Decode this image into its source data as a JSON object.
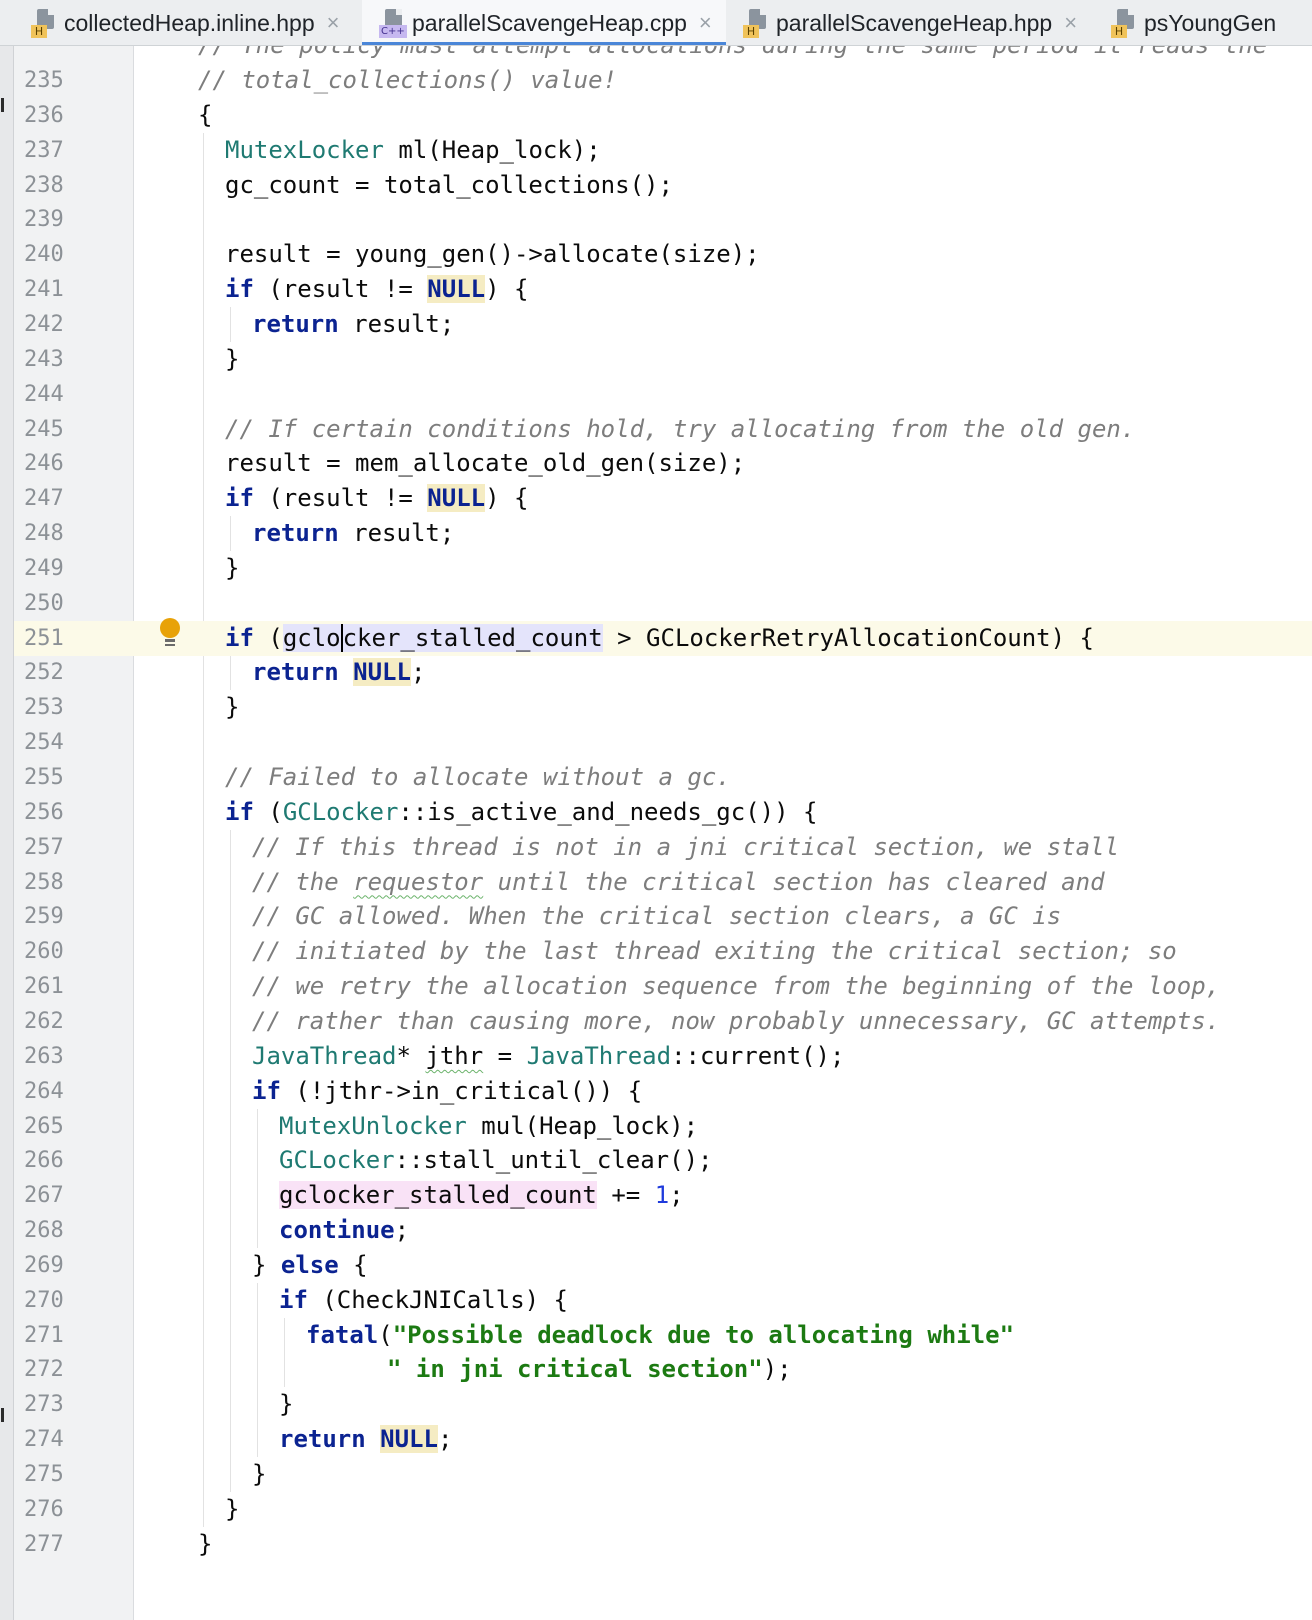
{
  "tabs": [
    {
      "name": "collectedHeap.inline.hpp",
      "badge": "H",
      "active": false
    },
    {
      "name": "parallelScavengeHeap.cpp",
      "badge": "C++",
      "active": true
    },
    {
      "name": "parallelScavengeHeap.hpp",
      "badge": "H",
      "active": false
    },
    {
      "name": "psYoungGen",
      "badge": "H",
      "active": false
    }
  ],
  "tab_close_glyph": "×",
  "editor": {
    "partial_line": "// The policy must attempt allocations during the same period it reads the",
    "current_line": 251,
    "lines": [
      {
        "n": 235,
        "indent": 0,
        "html": "<span class=\"cm\">// total_collections() value!</span>"
      },
      {
        "n": 236,
        "indent": 0,
        "html": "{"
      },
      {
        "n": 237,
        "indent": 1,
        "html": "<span class=\"ty\">MutexLocker</span> ml(Heap_lock);"
      },
      {
        "n": 238,
        "indent": 1,
        "html": "gc_count = total_collections();"
      },
      {
        "n": 239,
        "indent": 1,
        "html": ""
      },
      {
        "n": 240,
        "indent": 1,
        "html": "result = young_gen()-&gt;allocate(size);"
      },
      {
        "n": 241,
        "indent": 1,
        "html": "<span class=\"kw\">if</span> (result != <span class=\"nul\">NULL</span>) {"
      },
      {
        "n": 242,
        "indent": 2,
        "html": "<span class=\"kw\">return</span> result;"
      },
      {
        "n": 243,
        "indent": 1,
        "html": "}"
      },
      {
        "n": 244,
        "indent": 1,
        "html": ""
      },
      {
        "n": 245,
        "indent": 1,
        "html": "<span class=\"cm\">// If certain conditions hold, try allocating from the old gen.</span>"
      },
      {
        "n": 246,
        "indent": 1,
        "html": "result = mem_allocate_old_gen(size);"
      },
      {
        "n": 247,
        "indent": 1,
        "html": "<span class=\"kw\">if</span> (result != <span class=\"nul\">NULL</span>) {"
      },
      {
        "n": 248,
        "indent": 2,
        "html": "<span class=\"kw\">return</span> result;"
      },
      {
        "n": 249,
        "indent": 1,
        "html": "}"
      },
      {
        "n": 250,
        "indent": 1,
        "html": ""
      },
      {
        "n": 251,
        "indent": 1,
        "html": "<span class=\"kw\">if</span> (<span class=\"hl-read\">gclo<span class=\"caret\"></span>cker_stalled_count</span> &gt; GCLockerRetryAllocationCount) {"
      },
      {
        "n": 252,
        "indent": 2,
        "html": "<span class=\"kw\">return</span> <span class=\"nul\">NULL</span>;"
      },
      {
        "n": 253,
        "indent": 1,
        "html": "}"
      },
      {
        "n": 254,
        "indent": 1,
        "html": ""
      },
      {
        "n": 255,
        "indent": 1,
        "html": "<span class=\"cm\">// Failed to allocate without a gc.</span>"
      },
      {
        "n": 256,
        "indent": 1,
        "html": "<span class=\"kw\">if</span> (<span class=\"ty\">GCLocker</span>::is_active_and_needs_gc()) {"
      },
      {
        "n": 257,
        "indent": 2,
        "html": "<span class=\"cm\">// If this thread is not in a jni critical section, we stall</span>"
      },
      {
        "n": 258,
        "indent": 2,
        "html": "<span class=\"cm\">// the <span class=\"squig\">requestor</span> until the critical section has cleared and</span>"
      },
      {
        "n": 259,
        "indent": 2,
        "html": "<span class=\"cm\">// GC allowed. When the critical section clears, a GC is</span>"
      },
      {
        "n": 260,
        "indent": 2,
        "html": "<span class=\"cm\">// initiated by the last thread exiting the critical section; so</span>"
      },
      {
        "n": 261,
        "indent": 2,
        "html": "<span class=\"cm\">// we retry the allocation sequence from the beginning of the loop,</span>"
      },
      {
        "n": 262,
        "indent": 2,
        "html": "<span class=\"cm\">// rather than causing more, now probably unnecessary, GC attempts.</span>"
      },
      {
        "n": 263,
        "indent": 2,
        "html": "<span class=\"ty\">JavaThread</span>* <span class=\"squig\">jthr</span> = <span class=\"ty\">JavaThread</span>::current();"
      },
      {
        "n": 264,
        "indent": 2,
        "html": "<span class=\"kw\">if</span> (!jthr-&gt;in_critical()) {"
      },
      {
        "n": 265,
        "indent": 3,
        "html": "<span class=\"ty\">MutexUnlocker</span> mul(Heap_lock);"
      },
      {
        "n": 266,
        "indent": 3,
        "html": "<span class=\"ty\">GCLocker</span>::stall_until_clear();"
      },
      {
        "n": 267,
        "indent": 3,
        "html": "<span class=\"hl-write\">gclocker_stalled_count</span> += <span class=\"num\">1</span>;"
      },
      {
        "n": 268,
        "indent": 3,
        "html": "<span class=\"kw\">continue</span>;"
      },
      {
        "n": 269,
        "indent": 2,
        "html": "} <span class=\"kw\">else</span> {"
      },
      {
        "n": 270,
        "indent": 3,
        "html": "<span class=\"kw\">if</span> (CheckJNICalls) {"
      },
      {
        "n": 271,
        "indent": 4,
        "html": "<span class=\"fn\">fatal</span>(<span class=\"str\">\"Possible deadlock due to allocating while\"</span>"
      },
      {
        "n": 272,
        "indent": 7,
        "html": "<span class=\"str\">\" in jni critical section\"</span>);"
      },
      {
        "n": 273,
        "indent": 3,
        "html": "}"
      },
      {
        "n": 274,
        "indent": 3,
        "html": "<span class=\"kw\">return</span> <span class=\"nul\">NULL</span>;"
      },
      {
        "n": 275,
        "indent": 2,
        "html": "}"
      },
      {
        "n": 276,
        "indent": 1,
        "html": "}"
      },
      {
        "n": 277,
        "indent": 0,
        "html": "}"
      }
    ]
  }
}
